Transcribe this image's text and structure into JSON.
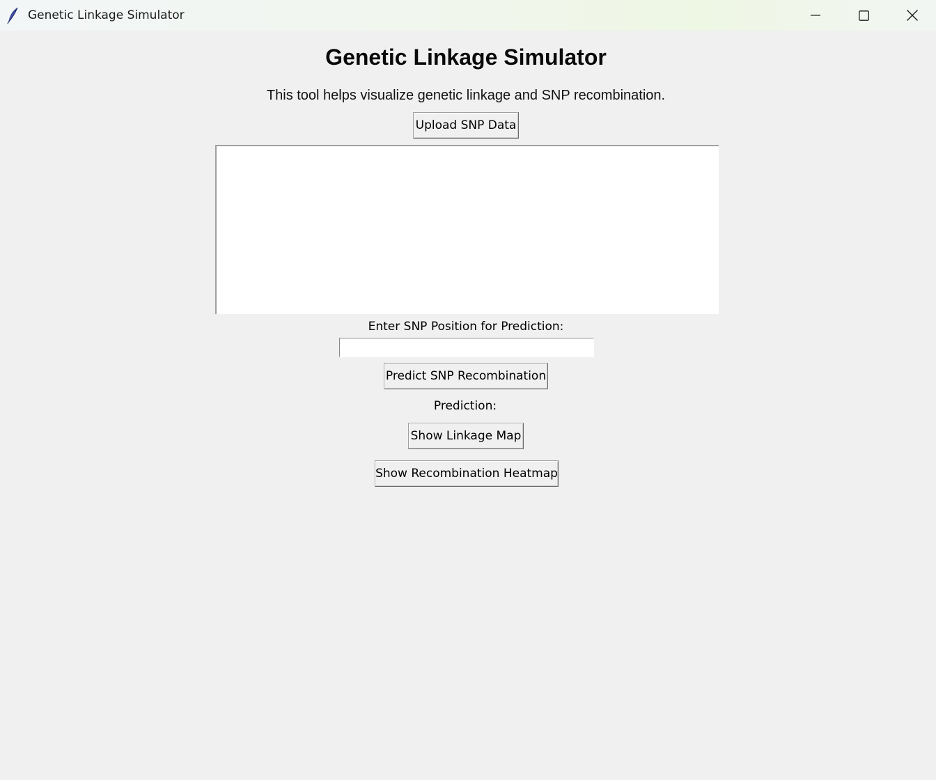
{
  "window": {
    "title": "Genetic Linkage Simulator",
    "icon": "feather-icon",
    "controls": [
      "minimize-icon",
      "maximize-icon",
      "close-icon"
    ]
  },
  "main": {
    "heading": "Genetic Linkage Simulator",
    "description": "This tool helps visualize genetic linkage and SNP recombination.",
    "upload_button": "Upload SNP Data",
    "data_area": {
      "value": ""
    },
    "position_label": "Enter SNP Position for Prediction:",
    "position_input": {
      "value": "",
      "placeholder": ""
    },
    "predict_button": "Predict SNP Recombination",
    "prediction_label": "Prediction:",
    "linkage_map_button": "Show Linkage Map",
    "heatmap_button": "Show Recombination Heatmap"
  },
  "colors": {
    "window_background": "#f0f0f0",
    "title_bar": "#f1f6ee",
    "text_area_background": "#ffffff"
  }
}
